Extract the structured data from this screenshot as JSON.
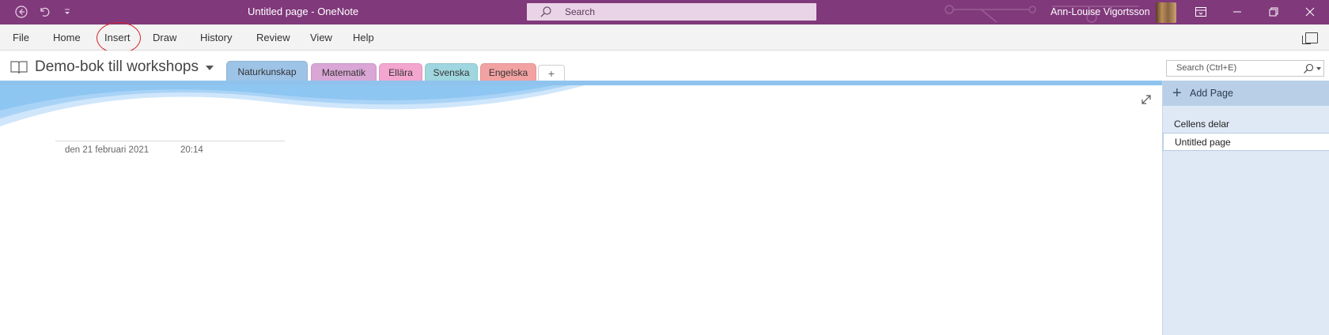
{
  "title_bar": {
    "page_title": "Untitled page",
    "separator": " - ",
    "app_name": "OneNote",
    "search_placeholder": "Search",
    "user_name": "Ann-Louise Vigortsson",
    "icons": [
      "back-icon",
      "undo-icon",
      "quick-access-dropdown-icon",
      "search-icon",
      "ribbon-display-options-icon",
      "minimize-icon",
      "restore-icon",
      "close-icon"
    ]
  },
  "ribbon": {
    "tabs": [
      "File",
      "Home",
      "Insert",
      "Draw",
      "History",
      "Review",
      "View",
      "Help"
    ],
    "highlighted_tab": "Insert",
    "annotation_color": "#d8232a"
  },
  "notebook": {
    "name": "Demo-bok till workshops",
    "sections": [
      {
        "label": "Naturkunskap",
        "color": "#9dc3e6",
        "active": true
      },
      {
        "label": "Matematik",
        "color": "#d9a6d6",
        "active": false
      },
      {
        "label": "Ellära",
        "color": "#f3a6cf",
        "active": false
      },
      {
        "label": "Svenska",
        "color": "#9fd6df",
        "active": false
      },
      {
        "label": "Engelska",
        "color": "#f2a2a2",
        "active": false
      }
    ],
    "add_section_symbol": "+",
    "search_placeholder": "Search (Ctrl+E)"
  },
  "page": {
    "date": "den 21 februari 2021",
    "time": "20:14"
  },
  "pages_pane": {
    "add_page_label": "Add Page",
    "pages": [
      {
        "label": "Cellens delar",
        "selected": false
      },
      {
        "label": "Untitled page",
        "selected": true
      }
    ]
  },
  "colors": {
    "title_bar": "#80397b",
    "ribbon": "#f3f3f3",
    "pages_pane": "#dfe9f5",
    "accent_blue": "#8fc3ee"
  }
}
